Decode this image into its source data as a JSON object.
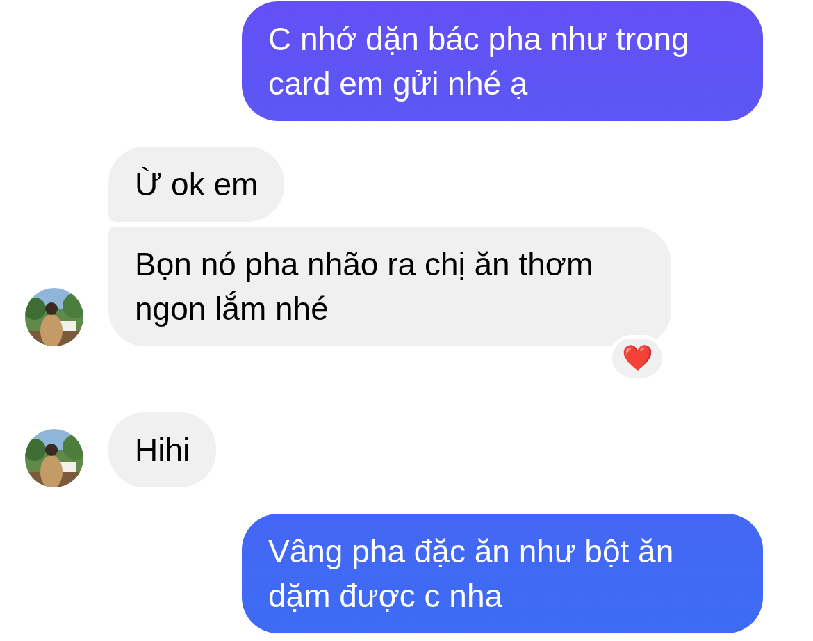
{
  "messages": [
    {
      "kind": "sent",
      "text": "C nhớ dặn bác pha như trong card em gửi nhé ạ"
    },
    {
      "kind": "received",
      "text": "Ừ ok em",
      "avatar": false
    },
    {
      "kind": "received",
      "text": "Bọn nó pha nhão ra chị ăn thơm ngon lắm nhé",
      "avatar": true,
      "reaction": "❤️"
    },
    {
      "kind": "received",
      "text": "Hihi",
      "avatar": true
    },
    {
      "kind": "sent",
      "text": "Vâng pha đặc ăn như bột ăn dặm được c nha"
    }
  ]
}
